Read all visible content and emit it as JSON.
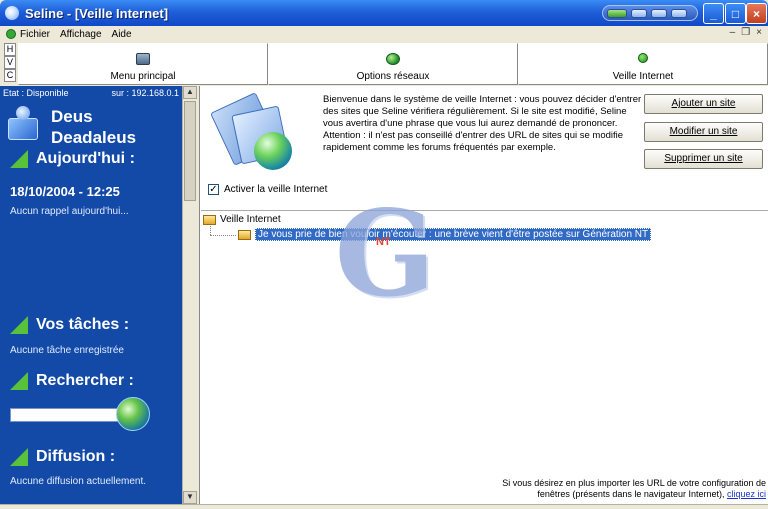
{
  "window": {
    "title": "Seline - [Veille Internet]"
  },
  "menu": {
    "items": [
      "Fichier",
      "Affichage",
      "Aide"
    ]
  },
  "vhc": [
    "H",
    "V",
    "C"
  ],
  "toolbar": [
    {
      "label": "Menu principal",
      "icon": "monitor-icon"
    },
    {
      "label": "Options réseaux",
      "icon": "network-globe-icon"
    },
    {
      "label": "Veille Internet",
      "icon": "status-dot-icon"
    }
  ],
  "sidebar": {
    "status": "Etat : Disponible",
    "ip": "sur : 192.168.0.1",
    "user_line1": "Deus",
    "user_line2": "Deadaleus",
    "today_title": "Aujourd'hui :",
    "date": "18/10/2004 - 12:25",
    "today_note": "Aucun rappel aujourd'hui...",
    "tasks_title": "Vos tâches :",
    "tasks_note": "Aucune tâche enregistrée",
    "search_title": "Rechercher :",
    "search_value": "",
    "diffusion_title": "Diffusion :",
    "diffusion_note": "Aucune diffusion actuellement."
  },
  "main": {
    "intro": "Bienvenue dans le système de veille Internet : vous pouvez décider d'entrer des sites que Seline vérifiera régulièrement. Si le site est modifié, Seline vous avertira d'une phrase que vous lui aurez demandé de prononcer. Attention : il n'est pas conseillé d'entrer des URL de sites qui se modifie rapidement comme les forums fréquentés par exemple.",
    "buttons": {
      "add": "Ajouter un site",
      "edit": "Modifier un site",
      "delete": "Supprimer un site"
    },
    "checkbox_label": "Activer la veille Internet",
    "checkbox_checked": true,
    "tree_root": "Veille Internet",
    "tree_child": "Je vous prie de bien vouloir m'écouter : une brève vient d'être postée sur Génération NT",
    "footer_text": "Si vous désirez en plus importer les URL de votre configuration de fenêtres (présents dans le navigateur Internet),",
    "footer_link": "cliquez ici"
  },
  "watermark": {
    "letter": "G",
    "badge": "NT"
  },
  "colors": {
    "sidebar_bg": "#134aa8",
    "accent_green": "#57c23a",
    "titlebar": "#1f5fd8",
    "selection": "#316ac5"
  }
}
